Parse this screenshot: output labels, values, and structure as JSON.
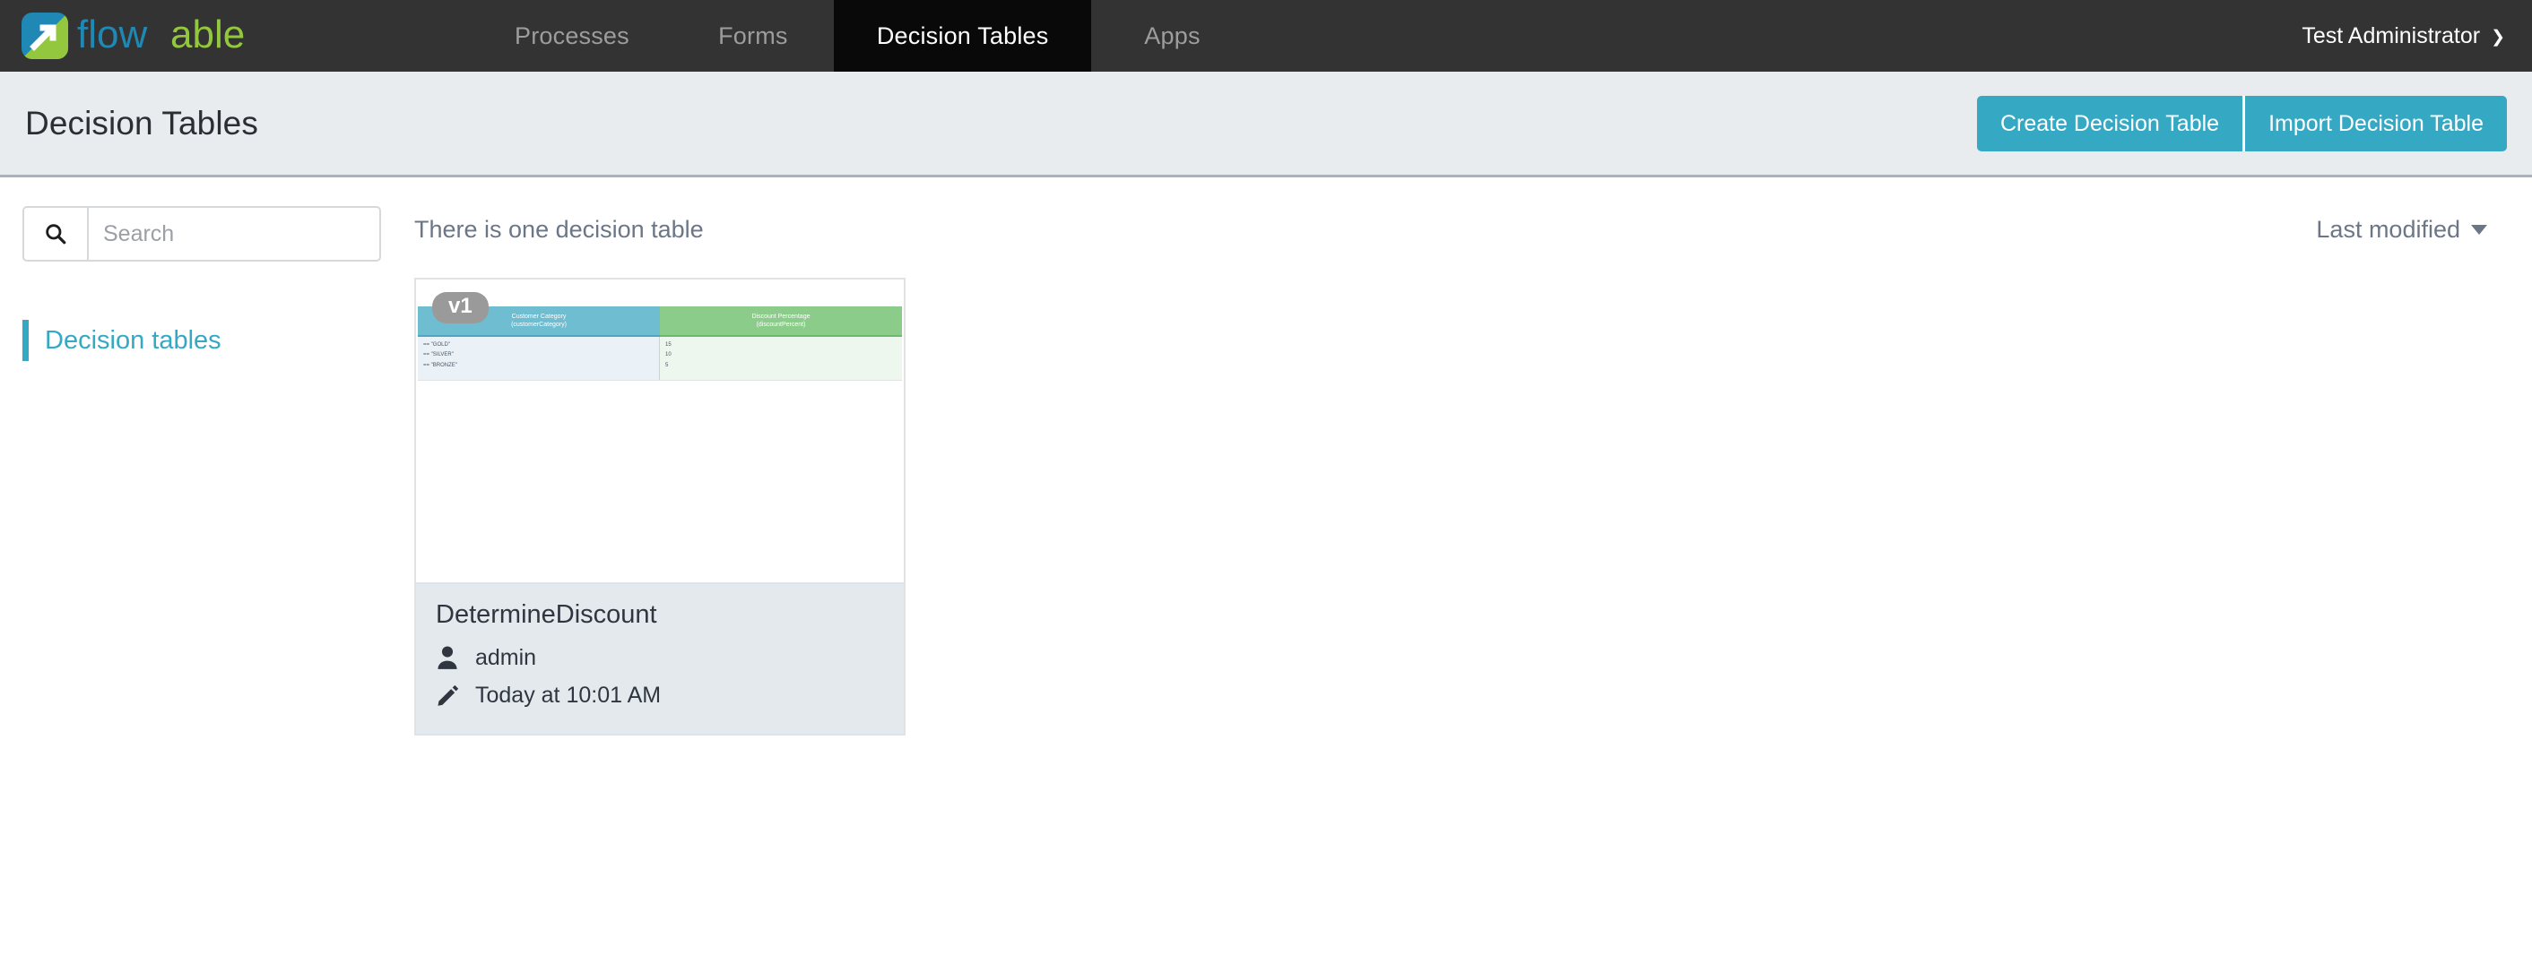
{
  "app": {
    "brand_name": "flowable",
    "brand_colors": {
      "blue": "#1f88b5",
      "green": "#93c83e",
      "bar": "#333333"
    }
  },
  "topnav": {
    "tabs": [
      {
        "label": "Processes",
        "active": false
      },
      {
        "label": "Forms",
        "active": false
      },
      {
        "label": "Decision Tables",
        "active": true
      },
      {
        "label": "Apps",
        "active": false
      }
    ],
    "user": {
      "name": "Test Administrator",
      "caret": "⌄"
    }
  },
  "header": {
    "title": "Decision Tables",
    "buttons": [
      {
        "label": "Create Decision Table"
      },
      {
        "label": "Import Decision Table"
      }
    ],
    "accent_color": "#35a9c4"
  },
  "sidebar": {
    "search": {
      "value": "",
      "placeholder": "Search",
      "icon": "search-icon"
    },
    "items": [
      {
        "label": "Decision tables",
        "active": true
      }
    ]
  },
  "main": {
    "result_count_text": "There is one decision table",
    "sort": {
      "label": "Last modified"
    },
    "cards": [
      {
        "version": "v1",
        "title": "DetermineDiscount",
        "author": "admin",
        "modified": "Today at 10:01 AM",
        "thumbnail": {
          "input_header_line1": "Customer Category",
          "input_header_line2": "(customerCategory)",
          "output_header_line1": "Discount Percentage",
          "output_header_line2": "(discountPercent)",
          "input_rows": [
            "== \"GOLD\"",
            "== \"SILVER\"",
            "== \"BRONZE\""
          ],
          "output_rows": [
            "15",
            "10",
            "5",
            ""
          ],
          "input_color": "#6ebdd1",
          "output_color": "#8bcc8b"
        }
      }
    ]
  }
}
